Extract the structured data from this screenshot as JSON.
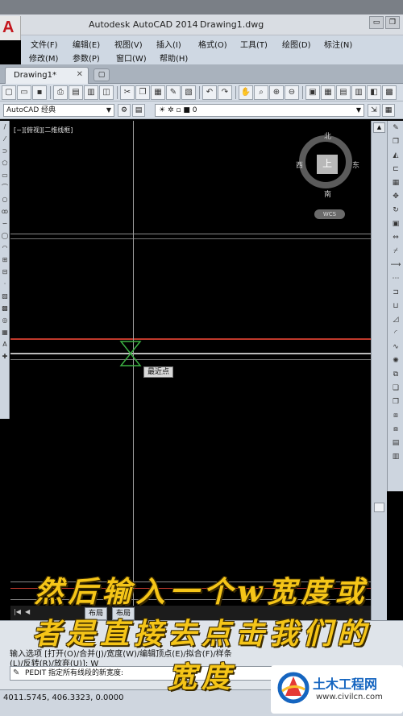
{
  "window": {
    "app_title": "Autodesk AutoCAD 2014",
    "file_title": "Drawing1.dwg",
    "btn_minimize": "▭",
    "btn_maximize": "❐",
    "btn_close": "✕"
  },
  "menu": {
    "row1": [
      "文件(F)",
      "编辑(E)",
      "视图(V)",
      "插入(I)",
      "格式(O)",
      "工具(T)",
      "绘图(D)",
      "标注(N)"
    ],
    "row2": [
      "修改(M)",
      "参数(P)",
      "窗口(W)",
      "帮助(H)"
    ]
  },
  "tabs": {
    "active_label": "Drawing1*",
    "close": "✕"
  },
  "toolbar2": {
    "workspace": "AutoCAD 经典",
    "layer": "0"
  },
  "canvas": {
    "viewport_label": "[−][俯视][二维线框]",
    "viewcube": {
      "north": "北",
      "south": "南",
      "east": "东",
      "west": "西",
      "face": "上",
      "wcs": "WCS"
    },
    "snap_tooltip": "最近点"
  },
  "layout_tabs": [
    "布局",
    "布局"
  ],
  "command": {
    "line1": "输入选项 [打开(O)/合并(J)/宽度(W)/编辑顶点(E)/拟合(F)/样条",
    "line2": "(L)/反转(R)/放弃(U)]: W",
    "prompt": "PEDIT 指定所有线段的新宽度:"
  },
  "status": {
    "coords": "4011.5745, 406.3323, 0.0000"
  },
  "subtitle": {
    "line1": "然后输入一个w宽度或",
    "line2": "者是直接去点击我们的",
    "line3": "宽度"
  },
  "watermark": {
    "title": "土木工程网",
    "url": "www.civilcn.com"
  },
  "colors": {
    "canvas_bg": "#000000",
    "red_line": "#c0392b",
    "subtitle": "#f5c518",
    "snap_marker": "#3cb043"
  }
}
